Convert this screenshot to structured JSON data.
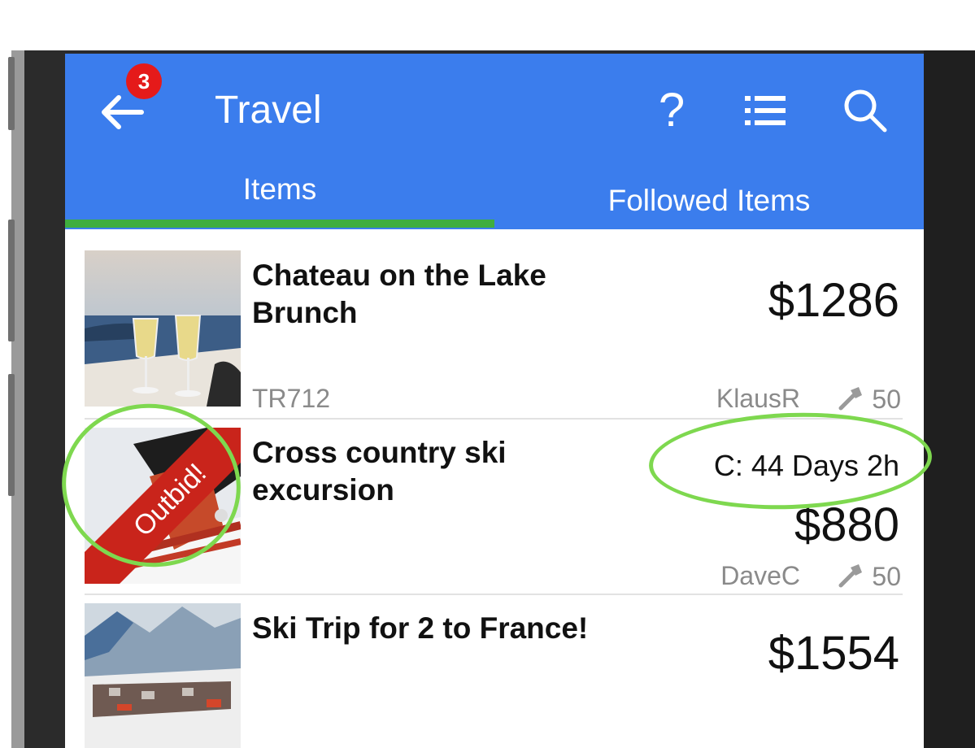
{
  "appbar": {
    "title": "Travel",
    "badge_count": "3",
    "help_label": "?",
    "back_icon": "arrow-left-icon",
    "list_icon": "list-icon",
    "search_icon": "search-icon"
  },
  "tabs": [
    {
      "label": "Items",
      "active": true
    },
    {
      "label": "Followed Items",
      "active": false
    }
  ],
  "items": [
    {
      "name": "Chateau on the Lake Brunch",
      "price": "$1286",
      "code": "TR712",
      "bidder": "KlausR",
      "bids": "50",
      "status": "",
      "countdown": ""
    },
    {
      "name": "Cross country ski excursion",
      "price": "$880",
      "code": "",
      "bidder": "DaveC",
      "bids": "50",
      "status": "Outbid!",
      "countdown": "C: 44 Days 2h"
    },
    {
      "name": "Ski Trip for 2 to France!",
      "price": "$1554",
      "code": "",
      "bidder": "",
      "bids": "",
      "status": "",
      "countdown": ""
    }
  ],
  "colors": {
    "appbar": "#3b7ded",
    "tab_indicator": "#3fae3f",
    "badge": "#e51a1a",
    "outbid": "#c9241b",
    "annotation": "#7ed84f"
  }
}
